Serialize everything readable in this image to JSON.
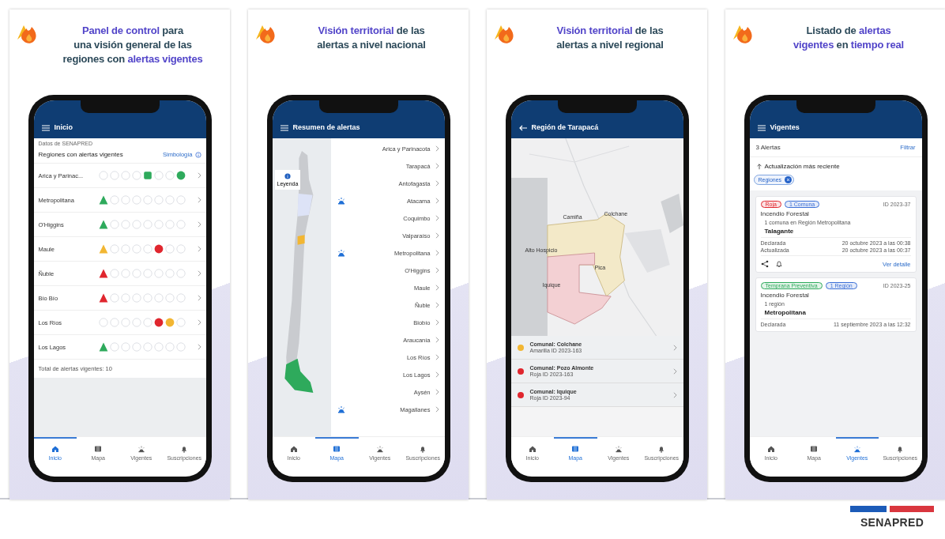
{
  "panels": [
    {
      "heading": [
        {
          "text": "Panel de control",
          "highlight": true
        },
        {
          "text": " para una visión general de las regiones con ",
          "highlight": false
        },
        {
          "text": "alertas vigentes",
          "highlight": true
        }
      ],
      "screen": {
        "kind": "home",
        "title": "Inicio",
        "source": "Datos de SENAPRED",
        "section": "Regiones con alertas vigentes",
        "link": "Simbología",
        "total": "Total de alertas vigentes: 10",
        "rows": [
          {
            "name": "Arica y Parinac...",
            "slots": [
              {
                "kind": "empty"
              },
              {
                "kind": "empty"
              },
              {
                "kind": "empty"
              },
              {
                "kind": "empty"
              },
              {
                "kind": "square",
                "color": "#2eaa5c"
              },
              {
                "kind": "empty"
              },
              {
                "kind": "empty"
              },
              {
                "kind": "circle",
                "color": "#2eaa5c"
              }
            ]
          },
          {
            "name": "Metropolitana",
            "slots": [
              {
                "kind": "triangle",
                "color": "#2eaa5c"
              },
              {
                "kind": "empty"
              },
              {
                "kind": "empty"
              },
              {
                "kind": "empty"
              },
              {
                "kind": "empty"
              },
              {
                "kind": "empty"
              },
              {
                "kind": "empty"
              },
              {
                "kind": "empty"
              }
            ]
          },
          {
            "name": "O'Higgins",
            "slots": [
              {
                "kind": "triangle",
                "color": "#2eaa5c"
              },
              {
                "kind": "empty"
              },
              {
                "kind": "empty"
              },
              {
                "kind": "empty"
              },
              {
                "kind": "empty"
              },
              {
                "kind": "empty"
              },
              {
                "kind": "empty"
              },
              {
                "kind": "empty"
              }
            ]
          },
          {
            "name": "Maule",
            "slots": [
              {
                "kind": "triangle",
                "color": "#f2b632"
              },
              {
                "kind": "empty"
              },
              {
                "kind": "empty"
              },
              {
                "kind": "empty"
              },
              {
                "kind": "empty"
              },
              {
                "kind": "circle",
                "color": "#e0262e"
              },
              {
                "kind": "empty"
              },
              {
                "kind": "empty"
              }
            ]
          },
          {
            "name": "Ñuble",
            "slots": [
              {
                "kind": "triangle",
                "color": "#e0262e"
              },
              {
                "kind": "empty"
              },
              {
                "kind": "empty"
              },
              {
                "kind": "empty"
              },
              {
                "kind": "empty"
              },
              {
                "kind": "empty"
              },
              {
                "kind": "empty"
              },
              {
                "kind": "empty"
              }
            ]
          },
          {
            "name": "Bío Bío",
            "slots": [
              {
                "kind": "triangle",
                "color": "#e0262e"
              },
              {
                "kind": "empty"
              },
              {
                "kind": "empty"
              },
              {
                "kind": "empty"
              },
              {
                "kind": "empty"
              },
              {
                "kind": "empty"
              },
              {
                "kind": "empty"
              },
              {
                "kind": "empty"
              }
            ]
          },
          {
            "name": "Los Ríos",
            "slots": [
              {
                "kind": "empty"
              },
              {
                "kind": "empty"
              },
              {
                "kind": "empty"
              },
              {
                "kind": "empty"
              },
              {
                "kind": "empty"
              },
              {
                "kind": "circle",
                "color": "#e0262e"
              },
              {
                "kind": "circle",
                "color": "#f2b632"
              },
              {
                "kind": "empty"
              }
            ]
          },
          {
            "name": "Los Lagos",
            "slots": [
              {
                "kind": "triangle",
                "color": "#2eaa5c"
              },
              {
                "kind": "empty"
              },
              {
                "kind": "empty"
              },
              {
                "kind": "empty"
              },
              {
                "kind": "empty"
              },
              {
                "kind": "empty"
              },
              {
                "kind": "empty"
              },
              {
                "kind": "empty"
              }
            ]
          }
        ]
      },
      "nav": [
        {
          "label": "Inicio",
          "selected": true
        },
        {
          "label": "Mapa",
          "selected": false
        },
        {
          "label": "Vigentes",
          "selected": false
        },
        {
          "label": "Suscripciones",
          "selected": false
        }
      ]
    },
    {
      "heading": [
        {
          "text": "Visión territorial",
          "highlight": true
        },
        {
          "text": " de las alertas a nivel nacional",
          "highlight": false
        }
      ],
      "screen": {
        "kind": "map",
        "title": "Resumen de alertas",
        "legend": "Leyenda",
        "regions": [
          {
            "name": "Arica y Parinacota",
            "alert": false
          },
          {
            "name": "Tarapacá",
            "alert": false
          },
          {
            "name": "Antofagasta",
            "alert": false
          },
          {
            "name": "Atacama",
            "alert": true
          },
          {
            "name": "Coquimbo",
            "alert": false
          },
          {
            "name": "Valparaíso",
            "alert": false
          },
          {
            "name": "Metropolitana",
            "alert": true
          },
          {
            "name": "O'Higgins",
            "alert": false
          },
          {
            "name": "Maule",
            "alert": false
          },
          {
            "name": "Ñuble",
            "alert": false
          },
          {
            "name": "Biobío",
            "alert": false
          },
          {
            "name": "Araucanía",
            "alert": false
          },
          {
            "name": "Los Ríos",
            "alert": false
          },
          {
            "name": "Los Lagos",
            "alert": false
          },
          {
            "name": "Aysén",
            "alert": false
          },
          {
            "name": "Magallanes",
            "alert": true
          }
        ]
      },
      "nav": [
        {
          "label": "Inicio",
          "selected": false
        },
        {
          "label": "Mapa",
          "selected": true
        },
        {
          "label": "Vigentes",
          "selected": false
        },
        {
          "label": "Suscripciones",
          "selected": false
        }
      ]
    },
    {
      "heading": [
        {
          "text": "Visión territorial",
          "highlight": true
        },
        {
          "text": " de las alertas a nivel regional",
          "highlight": false
        }
      ],
      "screen": {
        "kind": "region",
        "title": "Región de Tarapacá",
        "map_labels": [
          {
            "text": "Camiña"
          },
          {
            "text": "Colchane"
          },
          {
            "text": "Alto Hospicio"
          },
          {
            "text": "Pica"
          },
          {
            "text": "Iquique"
          }
        ],
        "alerts": [
          {
            "title": "Comunal: Colchane",
            "subtitle": "Amarilla ID 2023-163",
            "color": "#f2b632"
          },
          {
            "title": "Comunal: Pozo Almonte",
            "subtitle": "Roja ID 2023-163",
            "color": "#e0262e"
          },
          {
            "title": "Comunal: Iquique",
            "subtitle": "Roja ID 2023-94",
            "color": "#e0262e"
          }
        ]
      },
      "nav": [
        {
          "label": "Inicio",
          "selected": false
        },
        {
          "label": "Mapa",
          "selected": true
        },
        {
          "label": "Vigentes",
          "selected": false
        },
        {
          "label": "Suscripciones",
          "selected": false
        }
      ]
    },
    {
      "heading": [
        {
          "text": "Listado de ",
          "highlight": false
        },
        {
          "text": "alertas vigentes",
          "highlight": true
        },
        {
          "text": " en ",
          "highlight": false
        },
        {
          "text": "tiempo real",
          "highlight": true
        }
      ],
      "screen": {
        "kind": "list",
        "title": "Vigentes",
        "count": "3 Alertas",
        "filter": "Filtrar",
        "sort": "Actualización más reciente",
        "chip": "Regiones",
        "cards": [
          {
            "tags": [
              {
                "text": "Roja",
                "color": "#e0262e"
              },
              {
                "text": "1 Comuna",
                "color": "#3b6fd6"
              }
            ],
            "id": "ID 2023-37",
            "type": "Incendio Forestal",
            "scope": "1 comuna en Región Metropolitana",
            "place": "Talagante",
            "dates": [
              {
                "label": "Declarada",
                "value": "20 octubre 2023 a las 00:38"
              },
              {
                "label": "Actualizada",
                "value": "20 octubre 2023 a las 00:37"
              }
            ],
            "link": "Ver detalle"
          },
          {
            "tags": [
              {
                "text": "Temprana Preventiva",
                "color": "#2eaa5c"
              },
              {
                "text": "1 Región",
                "color": "#3b6fd6"
              }
            ],
            "id": "ID 2023-25",
            "type": "Incendio Forestal",
            "scope": "1 región",
            "place": "Metropolitana",
            "dates": [
              {
                "label": "Declarada",
                "value": "11 septiembre 2023 a las 12:32"
              }
            ]
          }
        ]
      },
      "nav": [
        {
          "label": "Inicio",
          "selected": false
        },
        {
          "label": "Mapa",
          "selected": false
        },
        {
          "label": "Vigentes",
          "selected": true
        },
        {
          "label": "Suscripciones",
          "selected": false
        }
      ]
    }
  ],
  "brand": "SENAPRED"
}
